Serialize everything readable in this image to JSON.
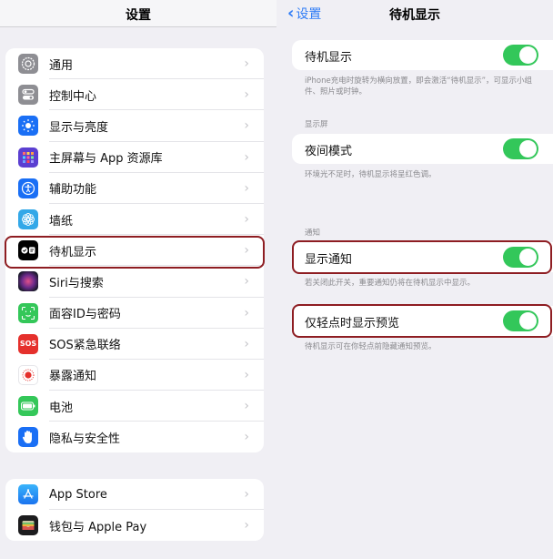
{
  "left": {
    "title": "设置",
    "group1": [
      {
        "label": "通用",
        "icon": "gear-icon"
      },
      {
        "label": "控制中心",
        "icon": "toggles-icon"
      },
      {
        "label": "显示与亮度",
        "icon": "sun-icon"
      },
      {
        "label": "主屏幕与 App 资源库",
        "icon": "home-grid-icon"
      },
      {
        "label": "辅助功能",
        "icon": "accessibility-icon"
      },
      {
        "label": "墙纸",
        "icon": "flower-icon"
      },
      {
        "label": "待机显示",
        "icon": "standby-icon"
      },
      {
        "label": "Siri与搜索",
        "icon": "siri-icon"
      },
      {
        "label": "面容ID与密码",
        "icon": "face-id-icon"
      },
      {
        "label": "SOS紧急联络",
        "icon": "sos-icon"
      },
      {
        "label": "暴露通知",
        "icon": "exposure-icon"
      },
      {
        "label": "电池",
        "icon": "battery-icon"
      },
      {
        "label": "隐私与安全性",
        "icon": "hand-icon"
      }
    ],
    "group2": [
      {
        "label": "App Store",
        "icon": "app-store-icon"
      },
      {
        "label": "钱包与 Apple Pay",
        "icon": "wallet-icon"
      }
    ],
    "sos_text": "SOS",
    "chevron": "›"
  },
  "right": {
    "back_label": "设置",
    "back_chevron": "‹",
    "title": "待机显示",
    "standby": {
      "label": "待机显示",
      "on": true,
      "footnote": "iPhone充电时旋转为横向放置，即会激活“待机显示”，可显示小组件、照片或时钟。"
    },
    "display_header": "显示屏",
    "night": {
      "label": "夜间模式",
      "on": true,
      "footnote": "环境光不足时，待机显示将呈红色调。"
    },
    "notif_header": "通知",
    "show_notif": {
      "label": "显示通知",
      "on": true,
      "footnote": "若关闭此开关，重要通知仍将在待机显示中显示。"
    },
    "preview": {
      "label": "仅轻点时显示预览",
      "on": true,
      "footnote": "待机显示可在你轻点前隐藏通知预览。"
    }
  },
  "colors": {
    "accent": "#2f7cf6",
    "toggle_on": "#33c75a",
    "highlight": "#8e1d22"
  }
}
